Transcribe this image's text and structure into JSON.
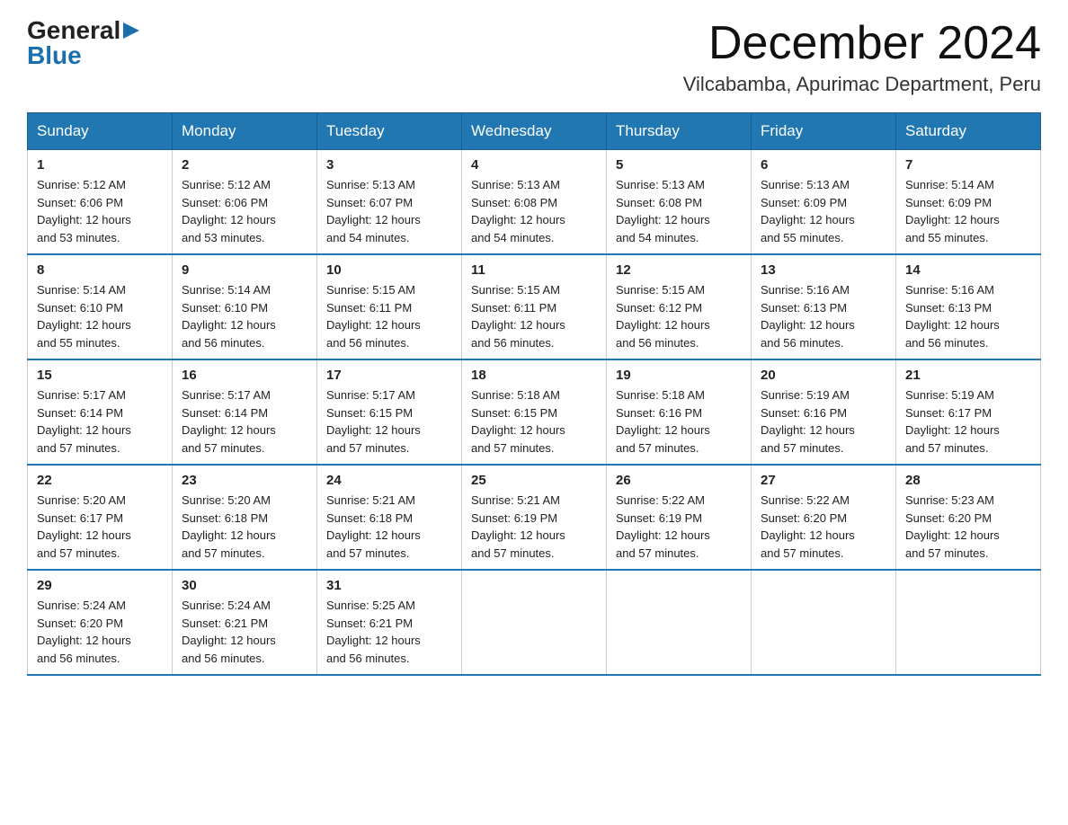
{
  "logo": {
    "general": "General",
    "blue": "Blue",
    "arrow": "▶"
  },
  "title": "December 2024",
  "subtitle": "Vilcabamba, Apurimac Department, Peru",
  "days_of_week": [
    "Sunday",
    "Monday",
    "Tuesday",
    "Wednesday",
    "Thursday",
    "Friday",
    "Saturday"
  ],
  "weeks": [
    [
      {
        "day": "1",
        "sunrise": "5:12 AM",
        "sunset": "6:06 PM",
        "daylight": "12 hours and 53 minutes."
      },
      {
        "day": "2",
        "sunrise": "5:12 AM",
        "sunset": "6:06 PM",
        "daylight": "12 hours and 53 minutes."
      },
      {
        "day": "3",
        "sunrise": "5:13 AM",
        "sunset": "6:07 PM",
        "daylight": "12 hours and 54 minutes."
      },
      {
        "day": "4",
        "sunrise": "5:13 AM",
        "sunset": "6:08 PM",
        "daylight": "12 hours and 54 minutes."
      },
      {
        "day": "5",
        "sunrise": "5:13 AM",
        "sunset": "6:08 PM",
        "daylight": "12 hours and 54 minutes."
      },
      {
        "day": "6",
        "sunrise": "5:13 AM",
        "sunset": "6:09 PM",
        "daylight": "12 hours and 55 minutes."
      },
      {
        "day": "7",
        "sunrise": "5:14 AM",
        "sunset": "6:09 PM",
        "daylight": "12 hours and 55 minutes."
      }
    ],
    [
      {
        "day": "8",
        "sunrise": "5:14 AM",
        "sunset": "6:10 PM",
        "daylight": "12 hours and 55 minutes."
      },
      {
        "day": "9",
        "sunrise": "5:14 AM",
        "sunset": "6:10 PM",
        "daylight": "12 hours and 56 minutes."
      },
      {
        "day": "10",
        "sunrise": "5:15 AM",
        "sunset": "6:11 PM",
        "daylight": "12 hours and 56 minutes."
      },
      {
        "day": "11",
        "sunrise": "5:15 AM",
        "sunset": "6:11 PM",
        "daylight": "12 hours and 56 minutes."
      },
      {
        "day": "12",
        "sunrise": "5:15 AM",
        "sunset": "6:12 PM",
        "daylight": "12 hours and 56 minutes."
      },
      {
        "day": "13",
        "sunrise": "5:16 AM",
        "sunset": "6:13 PM",
        "daylight": "12 hours and 56 minutes."
      },
      {
        "day": "14",
        "sunrise": "5:16 AM",
        "sunset": "6:13 PM",
        "daylight": "12 hours and 56 minutes."
      }
    ],
    [
      {
        "day": "15",
        "sunrise": "5:17 AM",
        "sunset": "6:14 PM",
        "daylight": "12 hours and 57 minutes."
      },
      {
        "day": "16",
        "sunrise": "5:17 AM",
        "sunset": "6:14 PM",
        "daylight": "12 hours and 57 minutes."
      },
      {
        "day": "17",
        "sunrise": "5:17 AM",
        "sunset": "6:15 PM",
        "daylight": "12 hours and 57 minutes."
      },
      {
        "day": "18",
        "sunrise": "5:18 AM",
        "sunset": "6:15 PM",
        "daylight": "12 hours and 57 minutes."
      },
      {
        "day": "19",
        "sunrise": "5:18 AM",
        "sunset": "6:16 PM",
        "daylight": "12 hours and 57 minutes."
      },
      {
        "day": "20",
        "sunrise": "5:19 AM",
        "sunset": "6:16 PM",
        "daylight": "12 hours and 57 minutes."
      },
      {
        "day": "21",
        "sunrise": "5:19 AM",
        "sunset": "6:17 PM",
        "daylight": "12 hours and 57 minutes."
      }
    ],
    [
      {
        "day": "22",
        "sunrise": "5:20 AM",
        "sunset": "6:17 PM",
        "daylight": "12 hours and 57 minutes."
      },
      {
        "day": "23",
        "sunrise": "5:20 AM",
        "sunset": "6:18 PM",
        "daylight": "12 hours and 57 minutes."
      },
      {
        "day": "24",
        "sunrise": "5:21 AM",
        "sunset": "6:18 PM",
        "daylight": "12 hours and 57 minutes."
      },
      {
        "day": "25",
        "sunrise": "5:21 AM",
        "sunset": "6:19 PM",
        "daylight": "12 hours and 57 minutes."
      },
      {
        "day": "26",
        "sunrise": "5:22 AM",
        "sunset": "6:19 PM",
        "daylight": "12 hours and 57 minutes."
      },
      {
        "day": "27",
        "sunrise": "5:22 AM",
        "sunset": "6:20 PM",
        "daylight": "12 hours and 57 minutes."
      },
      {
        "day": "28",
        "sunrise": "5:23 AM",
        "sunset": "6:20 PM",
        "daylight": "12 hours and 57 minutes."
      }
    ],
    [
      {
        "day": "29",
        "sunrise": "5:24 AM",
        "sunset": "6:20 PM",
        "daylight": "12 hours and 56 minutes."
      },
      {
        "day": "30",
        "sunrise": "5:24 AM",
        "sunset": "6:21 PM",
        "daylight": "12 hours and 56 minutes."
      },
      {
        "day": "31",
        "sunrise": "5:25 AM",
        "sunset": "6:21 PM",
        "daylight": "12 hours and 56 minutes."
      },
      null,
      null,
      null,
      null
    ]
  ],
  "labels": {
    "sunrise": "Sunrise:",
    "sunset": "Sunset:",
    "daylight": "Daylight:"
  }
}
